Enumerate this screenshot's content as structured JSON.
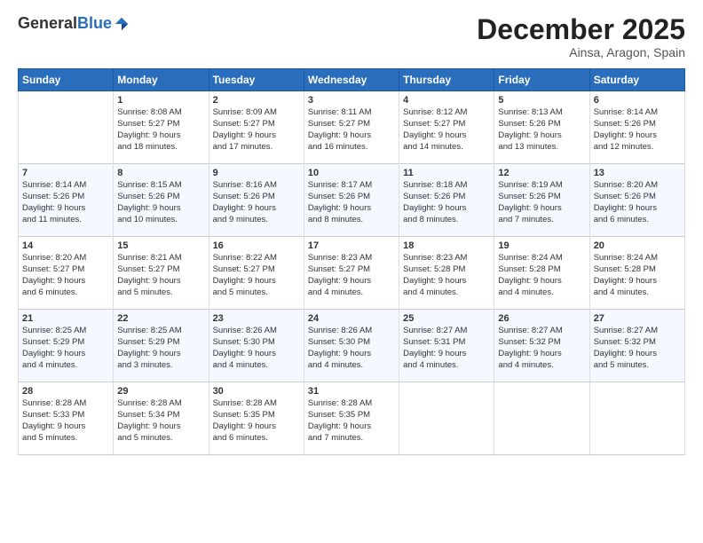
{
  "header": {
    "logo_general": "General",
    "logo_blue": "Blue",
    "month_title": "December 2025",
    "location": "Ainsa, Aragon, Spain"
  },
  "days_of_week": [
    "Sunday",
    "Monday",
    "Tuesday",
    "Wednesday",
    "Thursday",
    "Friday",
    "Saturday"
  ],
  "weeks": [
    [
      {
        "day": "",
        "info": ""
      },
      {
        "day": "1",
        "info": "Sunrise: 8:08 AM\nSunset: 5:27 PM\nDaylight: 9 hours\nand 18 minutes."
      },
      {
        "day": "2",
        "info": "Sunrise: 8:09 AM\nSunset: 5:27 PM\nDaylight: 9 hours\nand 17 minutes."
      },
      {
        "day": "3",
        "info": "Sunrise: 8:11 AM\nSunset: 5:27 PM\nDaylight: 9 hours\nand 16 minutes."
      },
      {
        "day": "4",
        "info": "Sunrise: 8:12 AM\nSunset: 5:27 PM\nDaylight: 9 hours\nand 14 minutes."
      },
      {
        "day": "5",
        "info": "Sunrise: 8:13 AM\nSunset: 5:26 PM\nDaylight: 9 hours\nand 13 minutes."
      },
      {
        "day": "6",
        "info": "Sunrise: 8:14 AM\nSunset: 5:26 PM\nDaylight: 9 hours\nand 12 minutes."
      }
    ],
    [
      {
        "day": "7",
        "info": "Sunrise: 8:14 AM\nSunset: 5:26 PM\nDaylight: 9 hours\nand 11 minutes."
      },
      {
        "day": "8",
        "info": "Sunrise: 8:15 AM\nSunset: 5:26 PM\nDaylight: 9 hours\nand 10 minutes."
      },
      {
        "day": "9",
        "info": "Sunrise: 8:16 AM\nSunset: 5:26 PM\nDaylight: 9 hours\nand 9 minutes."
      },
      {
        "day": "10",
        "info": "Sunrise: 8:17 AM\nSunset: 5:26 PM\nDaylight: 9 hours\nand 8 minutes."
      },
      {
        "day": "11",
        "info": "Sunrise: 8:18 AM\nSunset: 5:26 PM\nDaylight: 9 hours\nand 8 minutes."
      },
      {
        "day": "12",
        "info": "Sunrise: 8:19 AM\nSunset: 5:26 PM\nDaylight: 9 hours\nand 7 minutes."
      },
      {
        "day": "13",
        "info": "Sunrise: 8:20 AM\nSunset: 5:26 PM\nDaylight: 9 hours\nand 6 minutes."
      }
    ],
    [
      {
        "day": "14",
        "info": "Sunrise: 8:20 AM\nSunset: 5:27 PM\nDaylight: 9 hours\nand 6 minutes."
      },
      {
        "day": "15",
        "info": "Sunrise: 8:21 AM\nSunset: 5:27 PM\nDaylight: 9 hours\nand 5 minutes."
      },
      {
        "day": "16",
        "info": "Sunrise: 8:22 AM\nSunset: 5:27 PM\nDaylight: 9 hours\nand 5 minutes."
      },
      {
        "day": "17",
        "info": "Sunrise: 8:23 AM\nSunset: 5:27 PM\nDaylight: 9 hours\nand 4 minutes."
      },
      {
        "day": "18",
        "info": "Sunrise: 8:23 AM\nSunset: 5:28 PM\nDaylight: 9 hours\nand 4 minutes."
      },
      {
        "day": "19",
        "info": "Sunrise: 8:24 AM\nSunset: 5:28 PM\nDaylight: 9 hours\nand 4 minutes."
      },
      {
        "day": "20",
        "info": "Sunrise: 8:24 AM\nSunset: 5:28 PM\nDaylight: 9 hours\nand 4 minutes."
      }
    ],
    [
      {
        "day": "21",
        "info": "Sunrise: 8:25 AM\nSunset: 5:29 PM\nDaylight: 9 hours\nand 4 minutes."
      },
      {
        "day": "22",
        "info": "Sunrise: 8:25 AM\nSunset: 5:29 PM\nDaylight: 9 hours\nand 3 minutes."
      },
      {
        "day": "23",
        "info": "Sunrise: 8:26 AM\nSunset: 5:30 PM\nDaylight: 9 hours\nand 4 minutes."
      },
      {
        "day": "24",
        "info": "Sunrise: 8:26 AM\nSunset: 5:30 PM\nDaylight: 9 hours\nand 4 minutes."
      },
      {
        "day": "25",
        "info": "Sunrise: 8:27 AM\nSunset: 5:31 PM\nDaylight: 9 hours\nand 4 minutes."
      },
      {
        "day": "26",
        "info": "Sunrise: 8:27 AM\nSunset: 5:32 PM\nDaylight: 9 hours\nand 4 minutes."
      },
      {
        "day": "27",
        "info": "Sunrise: 8:27 AM\nSunset: 5:32 PM\nDaylight: 9 hours\nand 5 minutes."
      }
    ],
    [
      {
        "day": "28",
        "info": "Sunrise: 8:28 AM\nSunset: 5:33 PM\nDaylight: 9 hours\nand 5 minutes."
      },
      {
        "day": "29",
        "info": "Sunrise: 8:28 AM\nSunset: 5:34 PM\nDaylight: 9 hours\nand 5 minutes."
      },
      {
        "day": "30",
        "info": "Sunrise: 8:28 AM\nSunset: 5:35 PM\nDaylight: 9 hours\nand 6 minutes."
      },
      {
        "day": "31",
        "info": "Sunrise: 8:28 AM\nSunset: 5:35 PM\nDaylight: 9 hours\nand 7 minutes."
      },
      {
        "day": "",
        "info": ""
      },
      {
        "day": "",
        "info": ""
      },
      {
        "day": "",
        "info": ""
      }
    ]
  ]
}
